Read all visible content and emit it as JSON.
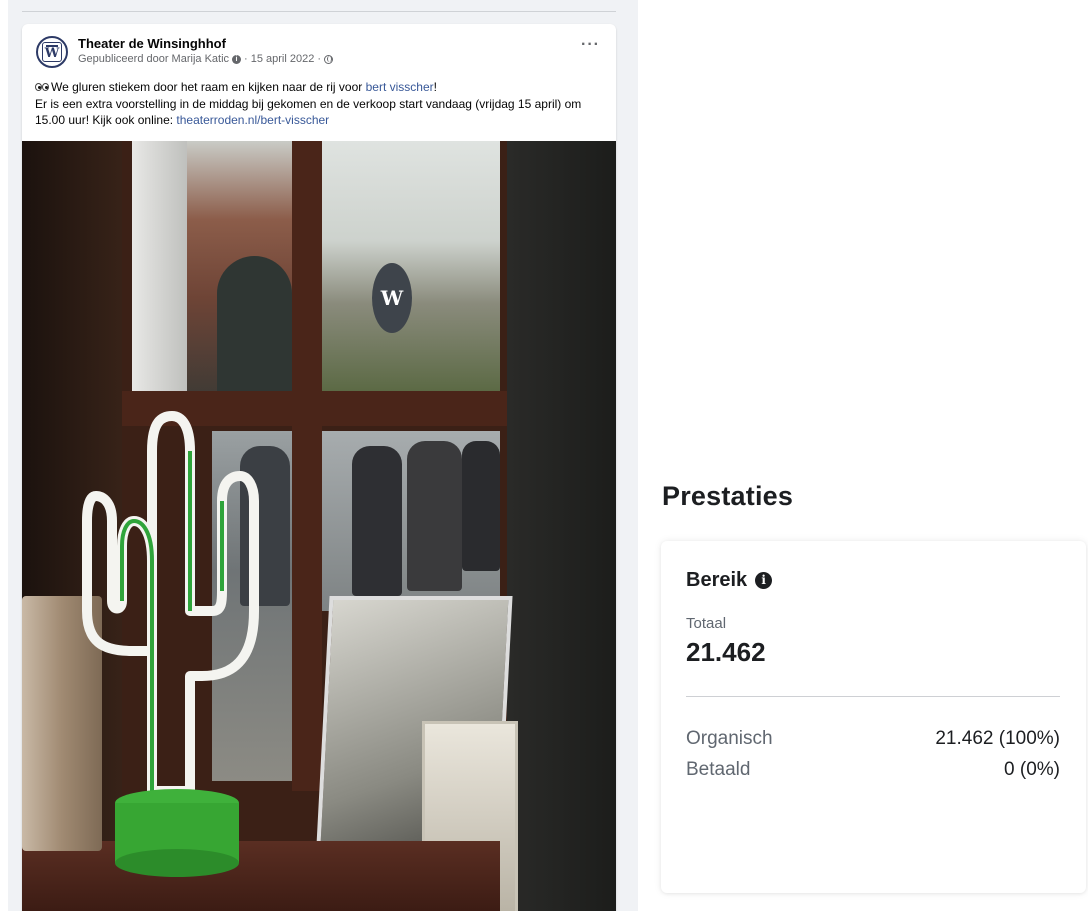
{
  "post": {
    "page_name": "Theater de Winsinghhof",
    "published_by": "Gepubliceerd door Marija Katic",
    "date": "15 april 2022",
    "line1_text": "We gluren stiekem door het raam en kijken naar de rij voor ",
    "line1_link": "bert visscher",
    "line1_end": "!",
    "line2_text": "Er is een extra voorstelling in de middag bij gekomen en de verkoop start vandaag (vrijdag 15 april) om 15.00 uur! Kijk ook online: ",
    "line2_link": "theaterroden.nl/bert-visscher",
    "avatar_letter": "W",
    "sign_letter": "W",
    "more_label": "···"
  },
  "performance": {
    "title": "Prestaties",
    "reach_title": "Bereik",
    "total_label": "Totaal",
    "total_value": "21.462",
    "rows": [
      {
        "label": "Organisch",
        "value": "21.462 (100%)"
      },
      {
        "label": "Betaald",
        "value": "0 (0%)"
      }
    ]
  },
  "icons": [
    "more-icon",
    "globe-icon",
    "info-icon",
    "eyes-icon",
    "verified-icon"
  ]
}
